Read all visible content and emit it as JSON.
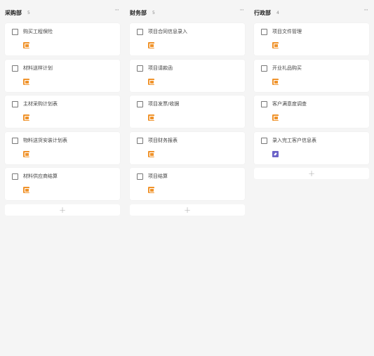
{
  "columns": [
    {
      "title": "采购部",
      "count": "5",
      "cards": [
        {
          "title": "购买工程保险",
          "tag": "orange"
        },
        {
          "title": "材料送样计划",
          "tag": "orange"
        },
        {
          "title": "主材采购计划表",
          "tag": "orange"
        },
        {
          "title": "物料送货安装计划表",
          "tag": "orange"
        },
        {
          "title": "材料供应商结算",
          "tag": "orange"
        }
      ],
      "add_label": "+"
    },
    {
      "title": "财务部",
      "count": "5",
      "cards": [
        {
          "title": "项目合同信息录入",
          "tag": "orange"
        },
        {
          "title": "项目请款函",
          "tag": "orange"
        },
        {
          "title": "项目发票/收据",
          "tag": "orange"
        },
        {
          "title": "项目财务报表",
          "tag": "orange"
        },
        {
          "title": "项目结算",
          "tag": "orange"
        }
      ],
      "add_label": "+"
    },
    {
      "title": "行政部",
      "count": "4",
      "cards": [
        {
          "title": "项目文件管理",
          "tag": "orange"
        },
        {
          "title": "开业礼品购买",
          "tag": "orange"
        },
        {
          "title": "客户满意度调查",
          "tag": "orange"
        },
        {
          "title": "录入完工客户信息表",
          "tag": "purple"
        }
      ],
      "add_label": "+"
    }
  ],
  "more_icon": "ellipsis-icon",
  "colors": {
    "tag_orange": "#f0932b",
    "tag_purple": "#6c63c8",
    "background": "#f5f5f5"
  }
}
